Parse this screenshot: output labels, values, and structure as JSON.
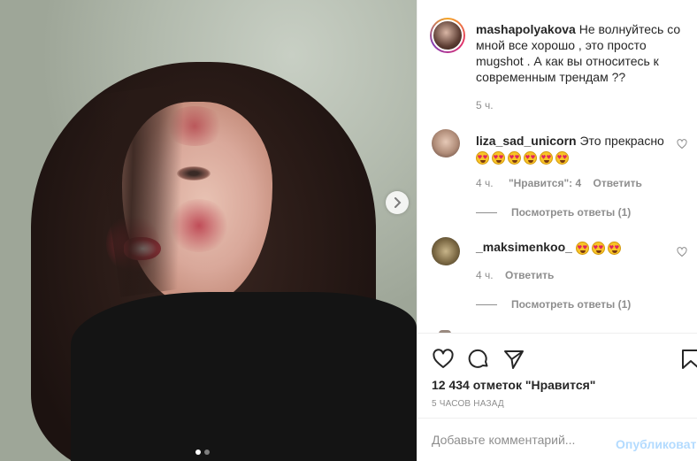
{
  "post": {
    "owner": "mashapolyakova",
    "caption": "Не волнуйтесь со мной все хорошо , это просто mugshot . А как вы относитесь к современным трендам ??",
    "caption_time": "5 ч.",
    "likes": "12 434 отметок \"Нравится\"",
    "posted_ago": "5 ЧАСОВ НАЗАД"
  },
  "comments": [
    {
      "user": "liza_sad_unicorn",
      "text": "Это прекрасно",
      "emoji_count": 6,
      "time": "4 ч.",
      "likes": "\"Нравится\": 4",
      "reply": "Ответить",
      "view_replies": "Посмотреть ответы (1)"
    },
    {
      "user": "_maksimenkoo_",
      "text": "",
      "emoji_count": 3,
      "time": "4 ч.",
      "reply": "Ответить",
      "view_replies": "Посмотреть ответы (1)"
    }
  ],
  "comment_box": {
    "placeholder": "Добавьте комментарий...",
    "publish_label": "Опубликовать"
  },
  "carousel": {
    "current": 1,
    "total": 2
  },
  "colors": {
    "link_blue_disabled": "#b3dbff",
    "muted": "#8e8e8e",
    "text": "#262626"
  }
}
